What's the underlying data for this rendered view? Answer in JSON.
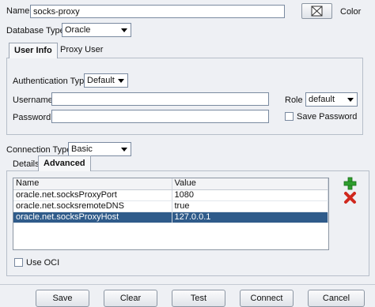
{
  "name": {
    "label": "Name",
    "value": "socks-proxy"
  },
  "color": {
    "label": "Color"
  },
  "database_type": {
    "label": "Database Type",
    "value": "Oracle"
  },
  "top_tabs": [
    {
      "label": "User Info"
    },
    {
      "label": "Proxy User"
    }
  ],
  "auth_type": {
    "label": "Authentication Type",
    "value": "Default"
  },
  "username": {
    "label": "Username",
    "value": ""
  },
  "password": {
    "label": "Password",
    "value": ""
  },
  "role": {
    "label": "Role",
    "value": "default"
  },
  "save_password": {
    "label": "Save Password",
    "checked": false
  },
  "connection_type": {
    "label": "Connection Type",
    "value": "Basic"
  },
  "bottom_tabs": [
    {
      "label": "Details"
    },
    {
      "label": "Advanced"
    }
  ],
  "properties": {
    "columns": [
      "Name",
      "Value"
    ],
    "rows": [
      {
        "name": "oracle.net.socksProxyPort",
        "value": "1080"
      },
      {
        "name": "oracle.net.socksremoteDNS",
        "value": "true"
      },
      {
        "name": "oracle.net.socksProxyHost",
        "value": "127.0.0.1"
      }
    ],
    "selected_index": 2
  },
  "use_oci": {
    "label": "Use OCI",
    "checked": false
  },
  "buttons": {
    "save": "Save",
    "clear": "Clear",
    "test": "Test",
    "connect": "Connect",
    "cancel": "Cancel"
  },
  "colors": {
    "selection": "#2f5b8a",
    "add_icon": "#2e9e2e",
    "remove_icon": "#d0281e"
  }
}
